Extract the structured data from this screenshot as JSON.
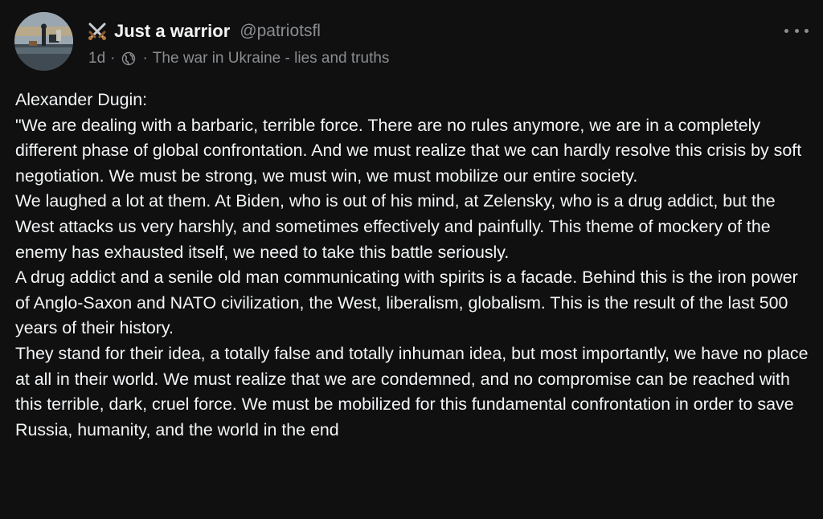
{
  "post": {
    "author": {
      "emoji_icon": "crossed-swords-icon",
      "display_name": "Just a warrior",
      "handle": "@patriotsfl",
      "avatar_icon": "avatar-image"
    },
    "meta": {
      "time": "1d",
      "separator": "·",
      "visibility_icon": "globe-icon",
      "community": "The war in Ukraine - lies and truths"
    },
    "more_icon": "more-options-icon",
    "body": "Alexander Dugin:\n\"We are dealing with a barbaric, terrible force. There are no rules anymore, we are in a completely different phase of global confrontation. And we must realize that we can hardly resolve this crisis by soft negotiation. We must be strong, we must win, we must mobilize our entire society.\nWe laughed a lot at them. At Biden, who is out of his mind, at Zelensky, who is a drug addict, but the West attacks us very harshly, and sometimes effectively and painfully. This theme of mockery of the enemy has exhausted itself, we need to take this battle seriously.\nA drug addict and a senile old man communicating with spirits is a facade. Behind this is the iron power of Anglo-Saxon and NATO civilization, the West, liberalism, globalism. This is the result of the last 500 years of their history.\nThey stand for their idea, a totally false and totally inhuman idea, but most importantly, we have no place at all in their world. We must realize that we are condemned, and no compromise can be reached with this terrible, dark, cruel force. We must be mobilized for this fundamental confrontation in order to save Russia, humanity, and the world in the end"
  },
  "colors": {
    "background": "#101010",
    "text_primary": "#f3f5f7",
    "text_secondary": "#8a8d91"
  }
}
